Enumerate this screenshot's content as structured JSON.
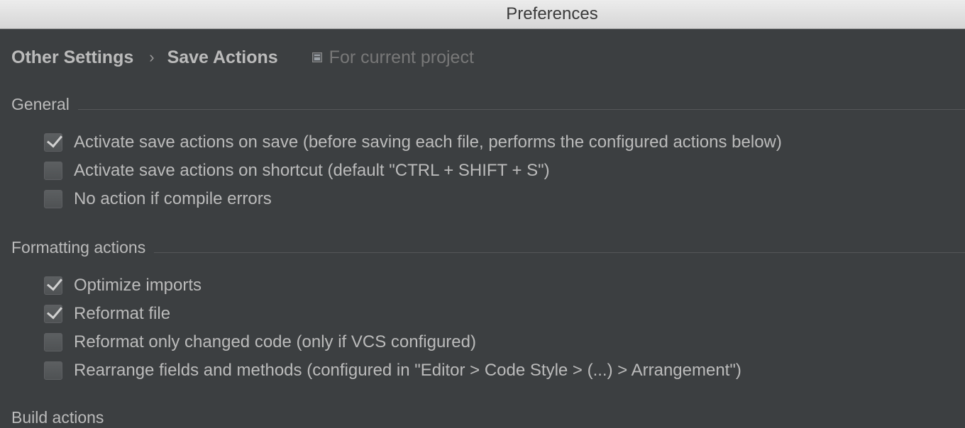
{
  "window": {
    "title": "Preferences"
  },
  "breadcrumb": {
    "items": [
      "Other Settings",
      "Save Actions"
    ],
    "separator": "›",
    "scope_label": "For current project"
  },
  "sections": {
    "general": {
      "title": "General",
      "options": [
        {
          "label": "Activate save actions on save (before saving each file, performs the configured actions below)",
          "checked": true
        },
        {
          "label": "Activate save actions on shortcut (default \"CTRL + SHIFT + S\")",
          "checked": false
        },
        {
          "label": "No action if compile errors",
          "checked": false
        }
      ]
    },
    "formatting": {
      "title": "Formatting actions",
      "options": [
        {
          "label": "Optimize imports",
          "checked": true
        },
        {
          "label": "Reformat file",
          "checked": true
        },
        {
          "label": "Reformat only changed code (only if VCS configured)",
          "checked": false
        },
        {
          "label": "Rearrange fields and methods (configured in \"Editor > Code Style > (...) > Arrangement\")",
          "checked": false
        }
      ]
    },
    "build": {
      "title": "Build actions"
    }
  },
  "colors": {
    "background": "#3c3f41",
    "text": "#bbbbbb",
    "muted": "#787878",
    "titlebar": "#e0e0e0"
  }
}
